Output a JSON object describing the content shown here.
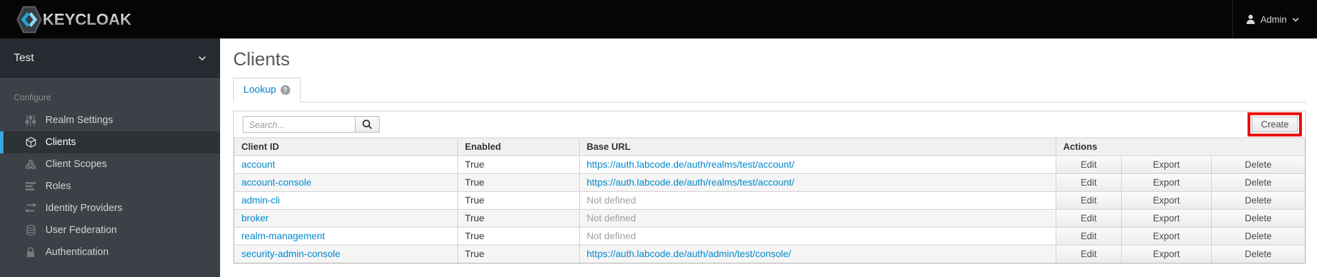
{
  "topbar": {
    "logo_text": "KEYCLOAK",
    "logo_icon": "keycloak-hexagon-icon",
    "user": {
      "icon": "user-icon",
      "name": "Admin",
      "dropdown_icon": "chevron-down-icon"
    }
  },
  "sidebar": {
    "realm": "Test",
    "realm_dropdown_icon": "chevron-down-icon",
    "section_label": "Configure",
    "items": [
      {
        "label": "Realm Settings",
        "icon": "sliders-icon",
        "selected": false
      },
      {
        "label": "Clients",
        "icon": "cube-icon",
        "selected": true
      },
      {
        "label": "Client Scopes",
        "icon": "cubes-icon",
        "selected": false
      },
      {
        "label": "Roles",
        "icon": "list-icon",
        "selected": false
      },
      {
        "label": "Identity Providers",
        "icon": "exchange-icon",
        "selected": false
      },
      {
        "label": "User Federation",
        "icon": "database-icon",
        "selected": false
      },
      {
        "label": "Authentication",
        "icon": "lock-icon",
        "selected": false
      }
    ]
  },
  "main": {
    "title": "Clients",
    "tab": {
      "label": "Lookup",
      "help_icon": "question-circle-icon"
    },
    "toolbar": {
      "search_placeholder": "Search...",
      "search_icon": "magnifier-icon",
      "create_label": "Create",
      "create_highlighted": true
    },
    "table": {
      "headers": {
        "client_id": "Client ID",
        "enabled": "Enabled",
        "base_url": "Base URL",
        "actions": "Actions"
      },
      "action_labels": {
        "edit": "Edit",
        "export": "Export",
        "delete": "Delete"
      },
      "rows": [
        {
          "client_id": "account",
          "enabled": "True",
          "base_url": "https://auth.labcode.de/auth/realms/test/account/",
          "base_url_link": true
        },
        {
          "client_id": "account-console",
          "enabled": "True",
          "base_url": "https://auth.labcode.de/auth/realms/test/account/",
          "base_url_link": true
        },
        {
          "client_id": "admin-cli",
          "enabled": "True",
          "base_url": "Not defined",
          "base_url_link": false
        },
        {
          "client_id": "broker",
          "enabled": "True",
          "base_url": "Not defined",
          "base_url_link": false
        },
        {
          "client_id": "realm-management",
          "enabled": "True",
          "base_url": "Not defined",
          "base_url_link": false
        },
        {
          "client_id": "security-admin-console",
          "enabled": "True",
          "base_url": "https://auth.labcode.de/auth/admin/test/console/",
          "base_url_link": true
        }
      ]
    }
  },
  "colors": {
    "link_blue": "#0088ce",
    "selected_nav_accent": "#3aa9dc",
    "annotation_red": "#ee0000",
    "topbar_bg": "#050505",
    "sidebar_bg": "#3b4147"
  }
}
